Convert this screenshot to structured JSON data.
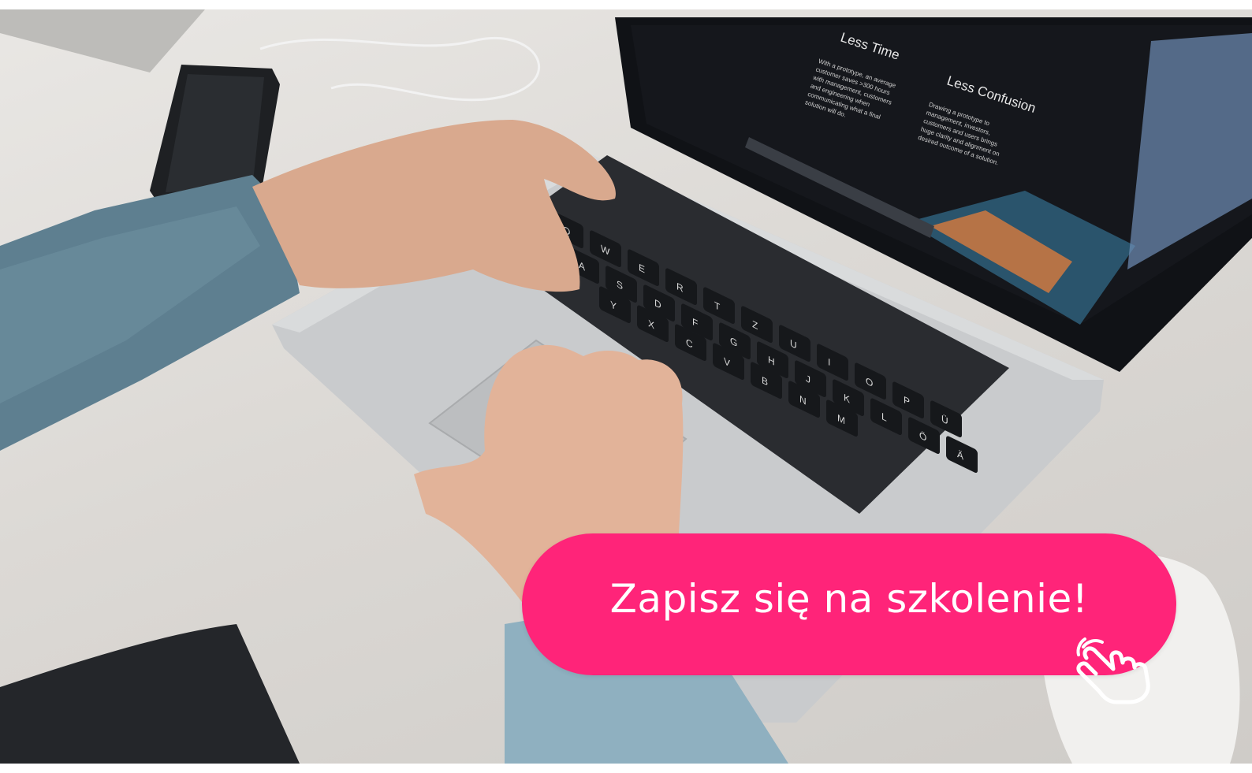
{
  "cta": {
    "label": "Zapisz się na szkolenie!"
  },
  "colors": {
    "accent": "#ff2479",
    "screen": "#15171c",
    "laptop": "#c9cbcd",
    "sleeve": "#5e7f90"
  },
  "icons": {
    "pointer": "hand-pointer-icon"
  },
  "photo": {
    "screen_columns": [
      {
        "heading": "Less Time",
        "body": "With a prototype, an average customer saves >300 hours with management, customers and engineering when communicating what a final solution will do."
      },
      {
        "heading": "Less Confusion",
        "body": "Drawing a prototype to management, investors, customers and users brings huge clarity and alignment on desired outcome of a solution."
      }
    ],
    "key_labels": [
      "Q",
      "W",
      "E",
      "R",
      "T",
      "Z",
      "U",
      "I",
      "O",
      "P",
      "Ü",
      "A",
      "S",
      "D",
      "F",
      "G",
      "H",
      "J",
      "K",
      "L",
      "Ö",
      "Ä",
      "Y",
      "X",
      "C",
      "V",
      "B",
      "N",
      "M"
    ]
  }
}
